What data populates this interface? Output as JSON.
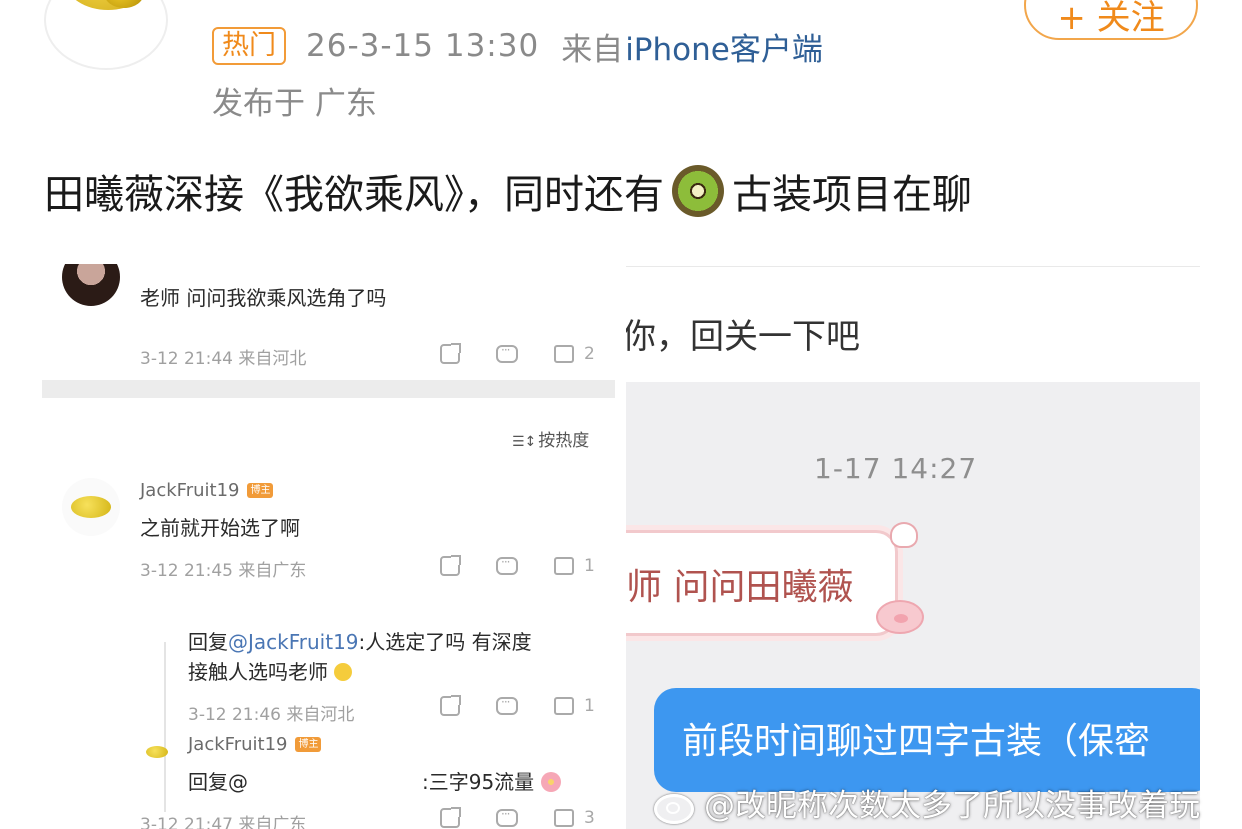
{
  "header": {
    "follow_label": "+ 关注",
    "hot_badge": "热门",
    "time": "26-3-15 13:30",
    "source_prefix": "来自",
    "source_client": "iPhone客户端",
    "location": "发布于 广东"
  },
  "post": {
    "text_before": "田曦薇深接《我欲乘风》，同时还有",
    "emoji": "kiwi-emoji",
    "text_after": "古装项目在聊"
  },
  "left_screenshot": {
    "comment1": {
      "text": "老师 问问我欲乘风选角了吗",
      "meta": "3-12 21:44 来自河北",
      "likes": "2"
    },
    "sort_label": "按热度",
    "comment2": {
      "name": "JackFruit19",
      "tag": "博主",
      "text": "之前就开始选了啊",
      "meta": "3-12 21:45 来自广东",
      "likes": "1"
    },
    "reply1": {
      "prefix": "回复",
      "mention": "@JackFruit19",
      "text_line1": ":人选定了吗 有深度",
      "text_line2": "接触人选吗老师",
      "meta": "3-12 21:46 来自河北",
      "likes": "1"
    },
    "reply2": {
      "name": "JackFruit19",
      "tag": "博主",
      "prefix": "回复@",
      "text": ":三字95流量",
      "meta": "3-12 21:47 来自广东",
      "likes": "3"
    }
  },
  "right_screenshot": {
    "top_text": "你，回关一下吧",
    "timestamp": "1-17 14:27",
    "incoming": "师 问问田曦薇",
    "outgoing": "前段时间聊过四字古装（保密"
  },
  "watermark": "@改昵称次数太多了所以没事改着玩",
  "colors": {
    "accent_orange": "#f08a1b",
    "link_blue": "#2f5f96",
    "chat_blue": "#3d97f0"
  }
}
